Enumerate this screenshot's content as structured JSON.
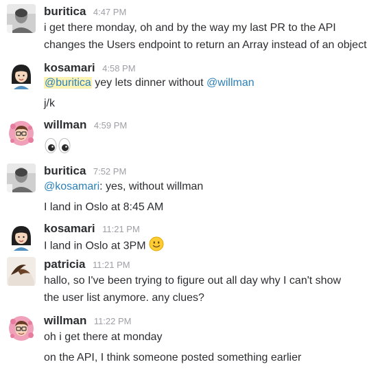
{
  "messages": [
    {
      "author": "buritica",
      "time": "4:47 PM",
      "avatar_icon": "buritica-avatar",
      "lines": [
        "i get there monday, oh and by the way my last PR to the API",
        "changes the Users endpoint to return an Array instead of an object"
      ]
    },
    {
      "author": "kosamari",
      "time": "4:58 PM",
      "avatar_icon": "kosamari-avatar",
      "line1": {
        "mention_self": "@buritica",
        "text": " yey lets dinner without ",
        "mention_other": "@willman"
      },
      "line2": "j/k"
    },
    {
      "author": "willman",
      "time": "4:59 PM",
      "avatar_icon": "willman-avatar",
      "emoji": "eyes-emoji"
    },
    {
      "author": "buritica",
      "time": "7:52 PM",
      "avatar_icon": "buritica-avatar",
      "line1": {
        "mention": "@kosamari",
        "text": ": yes, without willman"
      },
      "line2": "I land in Oslo at 8:45 AM"
    },
    {
      "author": "kosamari",
      "time": "11:21 PM",
      "avatar_icon": "kosamari-avatar",
      "text": "I land in Oslo at 3PM",
      "emoji": "slightly-smiling-face-emoji"
    },
    {
      "author": "patricia",
      "time": "11:21 PM",
      "avatar_icon": "patricia-avatar",
      "lines": [
        "hallo, so I've been trying to figure out all day why I can't show",
        "the user list anymore. any clues?"
      ]
    },
    {
      "author": "willman",
      "time": "11:22 PM",
      "avatar_icon": "willman-avatar",
      "lines": [
        "oh i get there at monday",
        "on the API, I think someone posted something earlier"
      ]
    }
  ],
  "colors": {
    "mention": "#2a80b9",
    "mention_highlight": "#fdf3b5",
    "timestamp": "#9e9ea6",
    "text": "#2c2d30"
  }
}
